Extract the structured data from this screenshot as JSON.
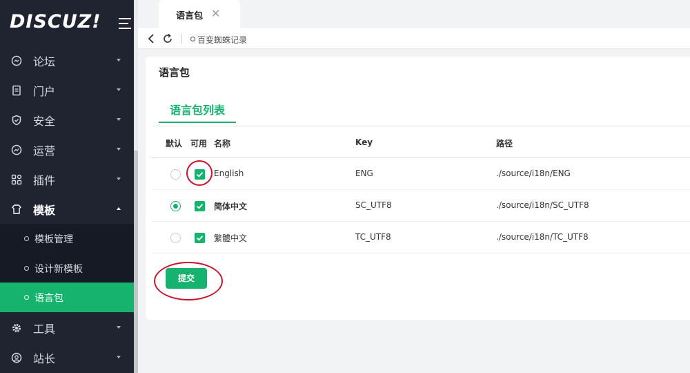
{
  "brand": {
    "logo_text": "DISCUZ!"
  },
  "sidebar": {
    "items": [
      {
        "label": "论坛",
        "icon": "forum-icon"
      },
      {
        "label": "门户",
        "icon": "portal-icon"
      },
      {
        "label": "安全",
        "icon": "shield-icon"
      },
      {
        "label": "运营",
        "icon": "operations-icon"
      },
      {
        "label": "插件",
        "icon": "plugin-icon"
      },
      {
        "label": "模板",
        "icon": "template-icon"
      },
      {
        "label": "工具",
        "icon": "gear-icon"
      },
      {
        "label": "站长",
        "icon": "webmaster-icon"
      }
    ],
    "submenu": [
      {
        "label": "模板管理"
      },
      {
        "label": "设计新模板"
      },
      {
        "label": "语言包"
      }
    ]
  },
  "tabs": [
    {
      "label": "语言包"
    }
  ],
  "addressbar": {
    "text": "百变蜘蛛记录"
  },
  "page": {
    "title": "语言包",
    "subtab": "语言包列表",
    "columns": {
      "default": "默认",
      "enabled": "可用",
      "name": "名称",
      "key": "Key",
      "path": "路径"
    },
    "rows": [
      {
        "default": false,
        "enabled": true,
        "name": "English",
        "key": "ENG",
        "path": "./source/i18n/ENG"
      },
      {
        "default": true,
        "enabled": true,
        "name": "简体中文",
        "key": "SC_UTF8",
        "path": "./source/i18n/SC_UTF8"
      },
      {
        "default": false,
        "enabled": true,
        "name": "繁體中文",
        "key": "TC_UTF8",
        "path": "./source/i18n/TC_UTF8"
      }
    ],
    "submit_label": "提交"
  },
  "colors": {
    "accent": "#16b36e",
    "sidebar_bg": "#1f2430",
    "annotation": "#c8142a"
  }
}
